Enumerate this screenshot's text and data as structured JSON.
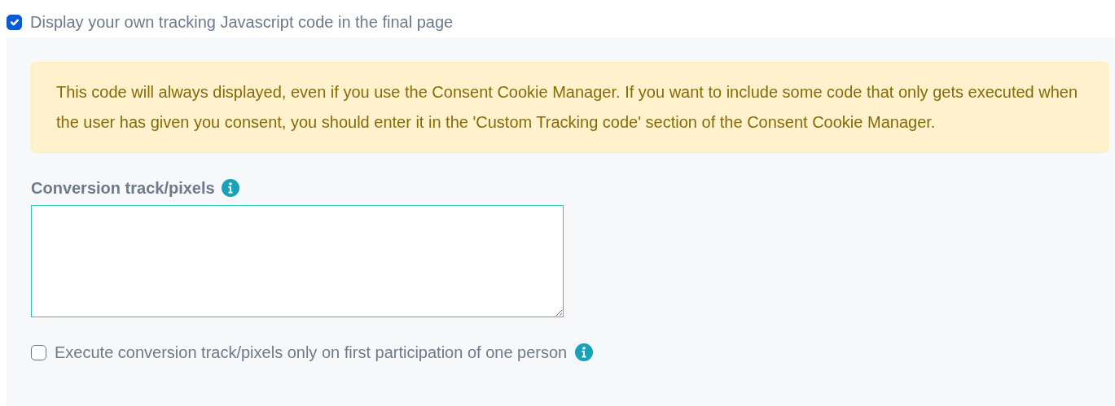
{
  "display_tracking": {
    "label": "Display your own tracking Javascript code in the final page",
    "checked": true
  },
  "alert": {
    "text": "This code will always displayed, even if you use the Consent Cookie Manager. If you want to include some code that only gets executed when the user has given you consent, you should enter it in the 'Custom Tracking code' section of the Consent Cookie Manager."
  },
  "conversion_field": {
    "label": "Conversion track/pixels"
  },
  "first_participation": {
    "label": "Execute conversion track/pixels only on first participation of one person",
    "checked": false
  }
}
